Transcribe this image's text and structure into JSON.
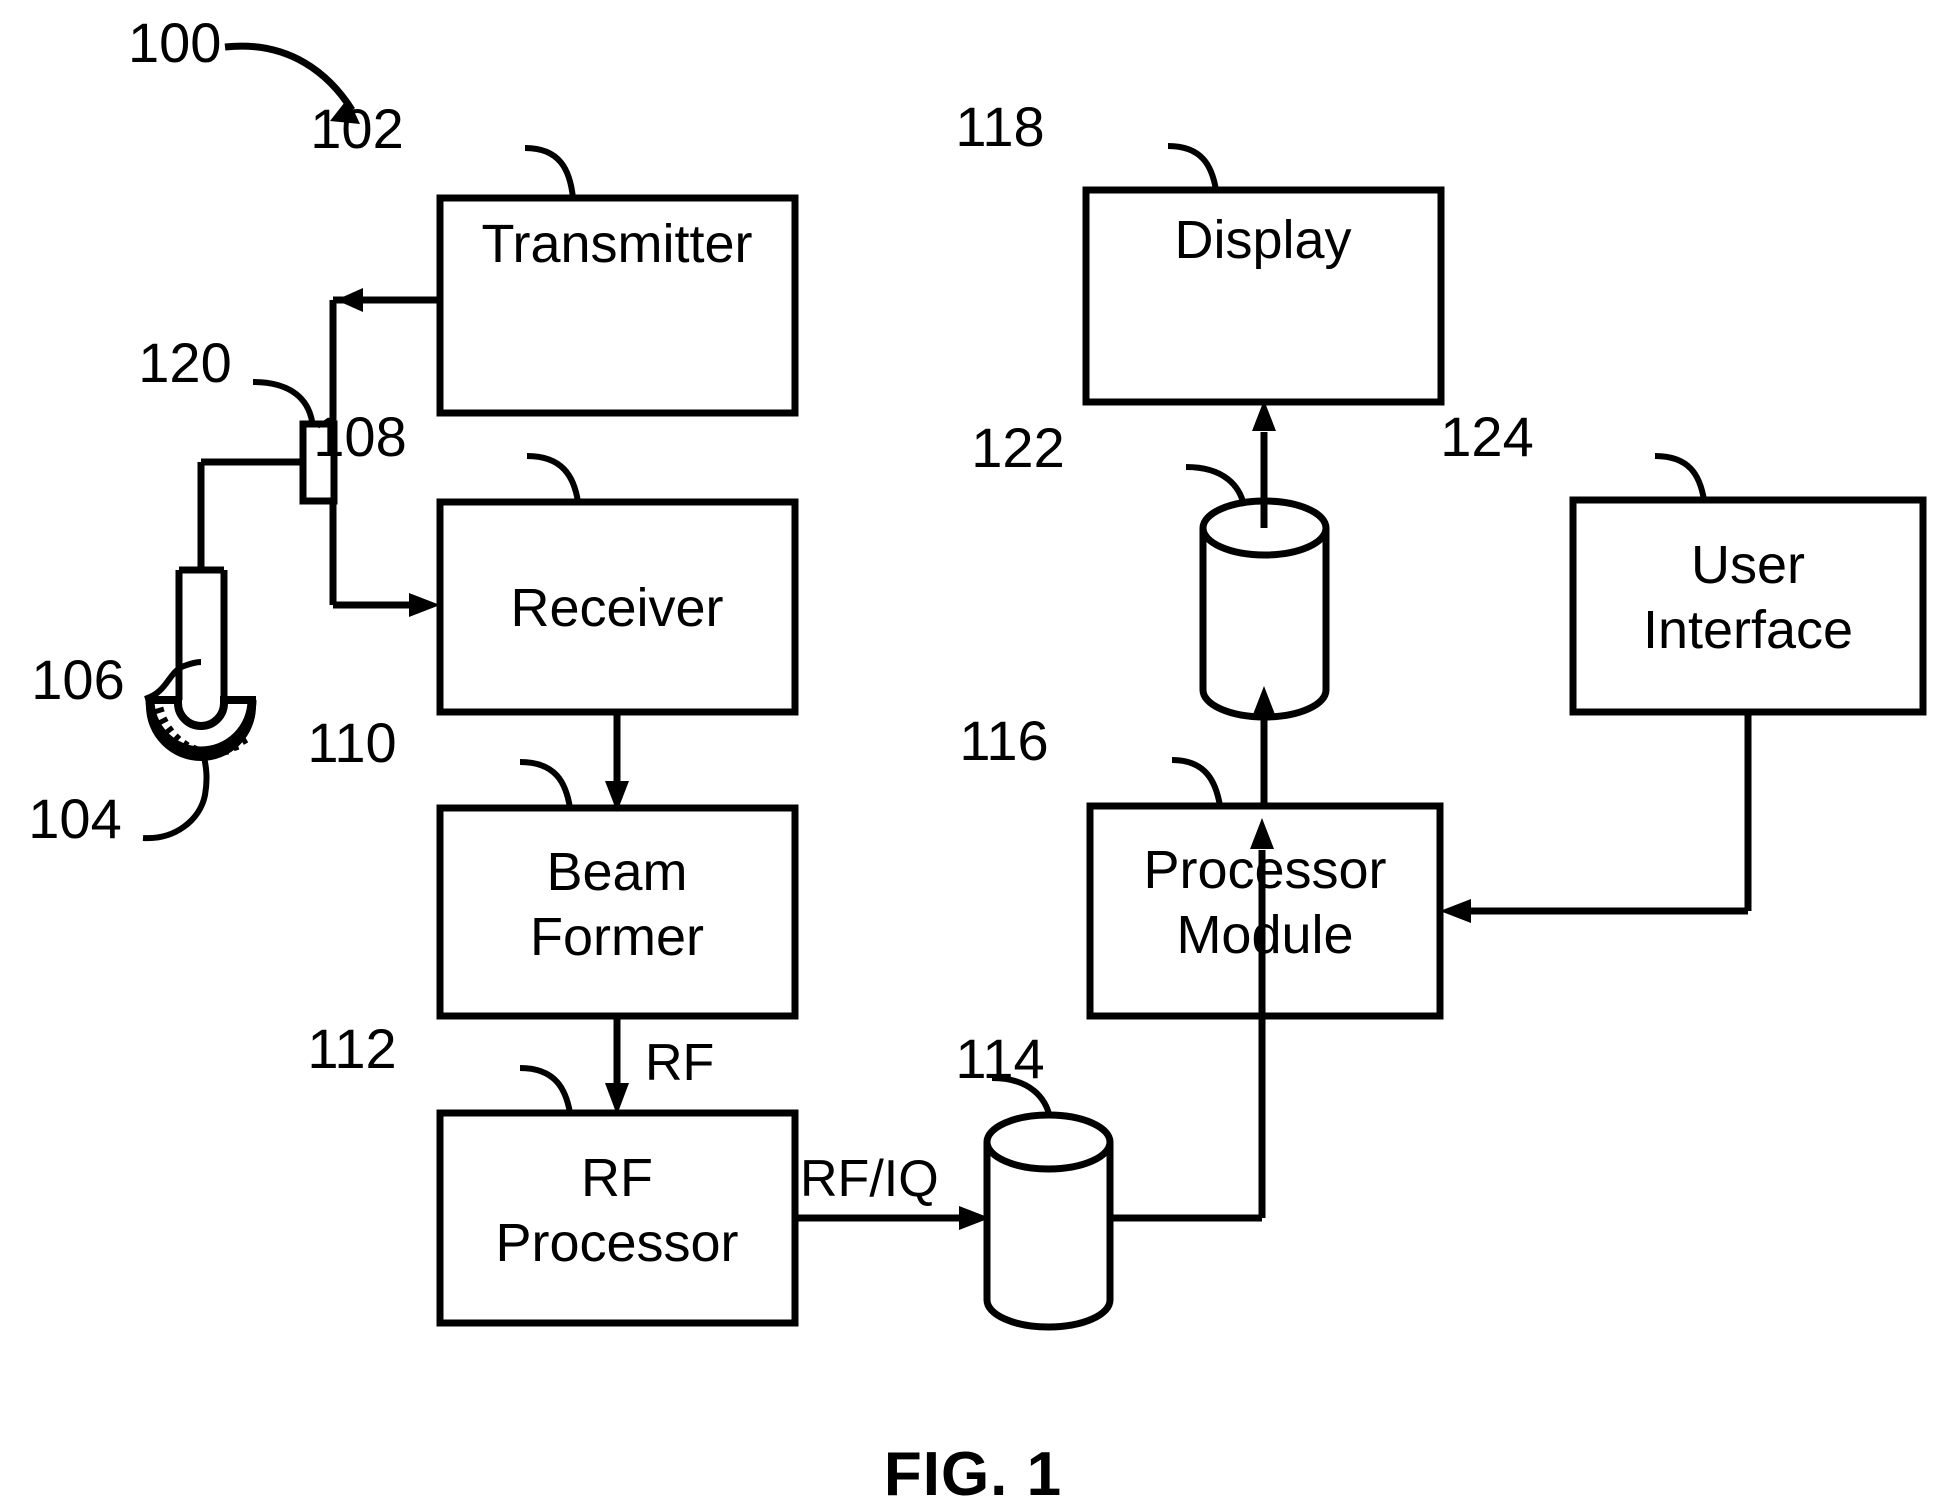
{
  "figure": {
    "caption": "FIG. 1",
    "system_ref": "100"
  },
  "blocks": [
    {
      "id": "transmitter",
      "label": "Transmitter",
      "ref": "102"
    },
    {
      "id": "receiver",
      "label": "Receiver",
      "ref": "108"
    },
    {
      "id": "beam-former",
      "label_line1": "Beam",
      "label_line2": "Former",
      "ref": "110"
    },
    {
      "id": "rf-processor",
      "label_line1": "RF",
      "label_line2": "Processor",
      "ref": "112"
    },
    {
      "id": "display",
      "label": "Display",
      "ref": "118"
    },
    {
      "id": "processor-module",
      "label_line1": "Processor",
      "label_line2": "Module",
      "ref": "116"
    },
    {
      "id": "user-interface",
      "label_line1": "User",
      "label_line2": "Interface",
      "ref": "124"
    }
  ],
  "stores": [
    {
      "id": "rf-iq-buffer",
      "ref": "114"
    },
    {
      "id": "image-memory",
      "ref": "122"
    }
  ],
  "components": [
    {
      "id": "tr-switch",
      "ref": "120"
    },
    {
      "id": "probe",
      "ref": "106"
    },
    {
      "id": "transducer-array",
      "ref": "104"
    }
  ],
  "edge_labels": {
    "beamformer_to_rf": "RF",
    "rf_to_buffer": "RF/IQ"
  },
  "colors": {
    "stroke": "#000000",
    "background": "#ffffff"
  }
}
